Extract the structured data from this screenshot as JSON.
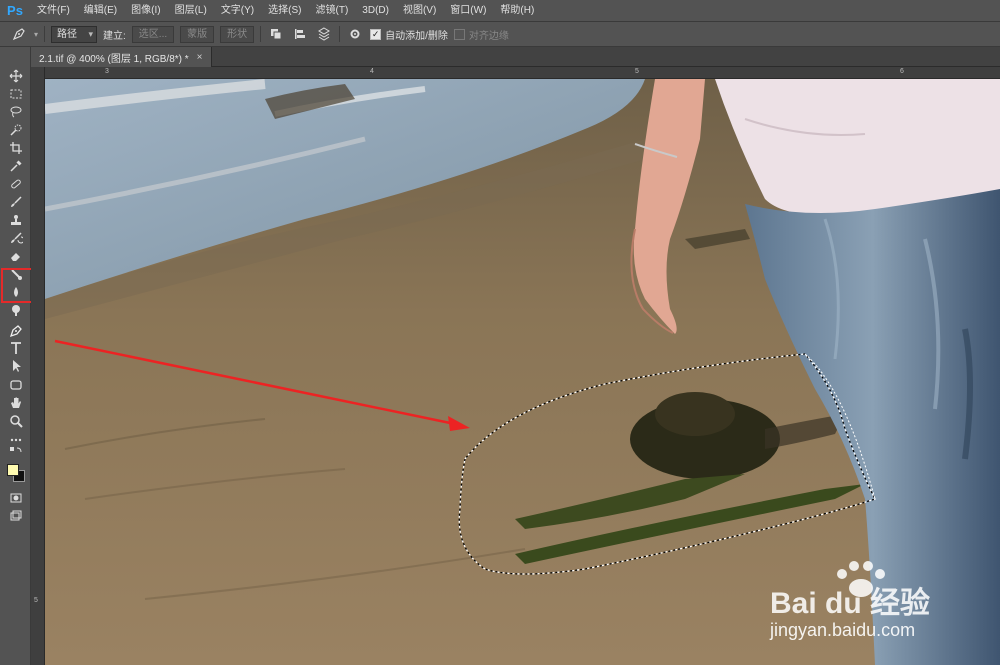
{
  "app": {
    "logo": "Ps"
  },
  "menu": [
    "文件(F)",
    "编辑(E)",
    "图像(I)",
    "图层(L)",
    "文字(Y)",
    "选择(S)",
    "滤镜(T)",
    "3D(D)",
    "视图(V)",
    "窗口(W)",
    "帮助(H)"
  ],
  "options": {
    "mode_select": "路径",
    "make_label": "建立:",
    "selection_btn": "选区...",
    "mask_btn": "蒙版",
    "shape_btn": "形状",
    "auto_add_delete": "自动添加/删除",
    "auto_add_delete_checked": true,
    "align_edges": "对齐边缘",
    "align_edges_checked": false
  },
  "document_tab": {
    "title": "2.1.tif @ 400% (图层 1, RGB/8*) *",
    "close": "×"
  },
  "rulers": {
    "top": [
      "3",
      "4",
      "5",
      "6"
    ],
    "left": [
      "5"
    ]
  },
  "tools": [
    "move-tool",
    "marquee-tool",
    "lasso-tool",
    "quick-select-tool",
    "crop-tool",
    "eyedropper-tool",
    "healing-brush-tool",
    "brush-tool",
    "clone-stamp-tool",
    "history-brush-tool",
    "eraser-tool",
    "gradient-tool",
    "blur-tool",
    "dodge-tool",
    "pen-tool",
    "type-tool",
    "path-selection-tool",
    "rectangle-tool",
    "hand-tool",
    "zoom-tool",
    "more-tools"
  ],
  "colors": {
    "foreground": "#fffbb0",
    "background": "#111111",
    "highlight": "#e42a2a"
  },
  "watermark": {
    "brand": "Bai du 经验",
    "url": "jingyan.baidu.com"
  }
}
